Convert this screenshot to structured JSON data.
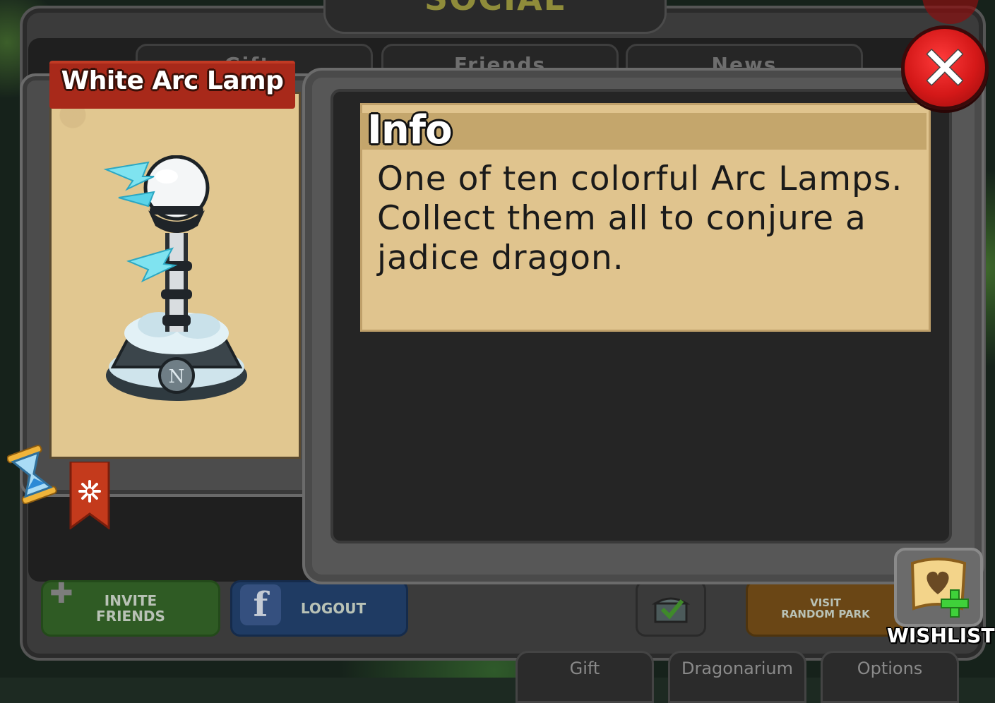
{
  "screen_title": "SOCIAL",
  "background_tabs": [
    {
      "label": "Gifts"
    },
    {
      "label": "Friends"
    },
    {
      "label": "News"
    }
  ],
  "item": {
    "name": "White Arc Lamp",
    "icon": "white-arc-lamp"
  },
  "info": {
    "header": "Info",
    "description": "One of ten colorful Arc Lamps. Collect them all to conjure a jadice dragon."
  },
  "bottom_buttons": {
    "invite_line1": "INVITE",
    "invite_line2": "FRIENDS",
    "logout": "LOGOUT",
    "visit_line1": "VISIT",
    "visit_line2": "RANDOM PARK"
  },
  "bottom_tabs": [
    {
      "label": "Gift"
    },
    {
      "label": "Dragonarium"
    },
    {
      "label": "Options"
    }
  ],
  "wishlist": {
    "label": "WISHLIST"
  },
  "colors": {
    "close_red": "#d41818",
    "banner_red": "#a8291a",
    "parchment": "#e0c48e",
    "panel_gray": "#575757"
  }
}
